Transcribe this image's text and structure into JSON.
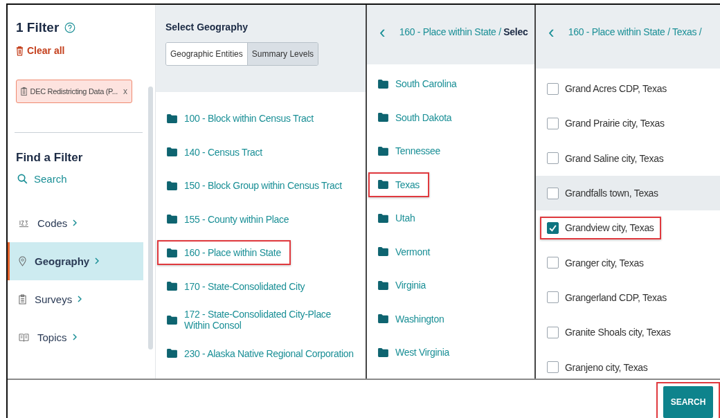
{
  "filter_panel": {
    "title": "1 Filter",
    "clear_label": "Clear all",
    "chips": [
      {
        "label": "DEC Redistricting Data (P...",
        "remove": "x"
      }
    ],
    "find_title": "Find a Filter",
    "search_label": "Search",
    "nav": [
      {
        "kind": "codes",
        "label": "Codes",
        "selected": false
      },
      {
        "kind": "geography",
        "label": "Geography",
        "selected": true
      },
      {
        "kind": "surveys",
        "label": "Surveys",
        "selected": false
      },
      {
        "kind": "topics",
        "label": "Topics",
        "selected": false
      }
    ]
  },
  "geography_column": {
    "title": "Select Geography",
    "tabs": [
      {
        "label": "Geographic Entities",
        "selected": true
      },
      {
        "label": "Summary Levels",
        "selected": false
      }
    ],
    "items": [
      {
        "label": "100 - Block within Census Tract",
        "highlighted": false
      },
      {
        "label": "140 - Census Tract",
        "highlighted": false
      },
      {
        "label": "150 - Block Group within Census Tract",
        "highlighted": false
      },
      {
        "label": "155 - County within Place",
        "highlighted": false
      },
      {
        "label": "160 - Place within State",
        "highlighted": true
      },
      {
        "label": "170 - State-Consolidated City",
        "highlighted": false
      },
      {
        "label": "172 - State-Consolidated City-Place Within Consol",
        "highlighted": false
      },
      {
        "label": "230 - Alaska Native Regional Corporation",
        "highlighted": false
      }
    ]
  },
  "state_column": {
    "back": "‹",
    "breadcrumb": "160 - Place within State / **Selec**",
    "items": [
      {
        "label": "South Carolina",
        "highlighted": false
      },
      {
        "label": "South Dakota",
        "highlighted": false
      },
      {
        "label": "Tennessee",
        "highlighted": false
      },
      {
        "label": "Texas",
        "highlighted": true
      },
      {
        "label": "Utah",
        "highlighted": false
      },
      {
        "label": "Vermont",
        "highlighted": false
      },
      {
        "label": "Virginia",
        "highlighted": false
      },
      {
        "label": "Washington",
        "highlighted": false
      },
      {
        "label": "West Virginia",
        "highlighted": false
      }
    ]
  },
  "place_column": {
    "back": "‹",
    "breadcrumb": "160 - Place within State / Texas /",
    "items": [
      {
        "label": "Grand Acres CDP, Texas",
        "checked": false,
        "hovered": false,
        "highlighted": false
      },
      {
        "label": "Grand Prairie city, Texas",
        "checked": false,
        "hovered": false,
        "highlighted": false
      },
      {
        "label": "Grand Saline city, Texas",
        "checked": false,
        "hovered": false,
        "highlighted": false
      },
      {
        "label": "Grandfalls town, Texas",
        "checked": false,
        "hovered": true,
        "highlighted": false
      },
      {
        "label": "Grandview city, Texas",
        "checked": true,
        "hovered": false,
        "highlighted": true
      },
      {
        "label": "Granger city, Texas",
        "checked": false,
        "hovered": false,
        "highlighted": false
      },
      {
        "label": "Grangerland CDP, Texas",
        "checked": false,
        "hovered": false,
        "highlighted": false
      },
      {
        "label": "Granite Shoals city, Texas",
        "checked": false,
        "hovered": false,
        "highlighted": false
      },
      {
        "label": "Granjeno city, Texas",
        "checked": false,
        "hovered": false,
        "highlighted": false
      }
    ]
  },
  "footer": {
    "search_button": "SEARCH",
    "highlighted": true
  }
}
